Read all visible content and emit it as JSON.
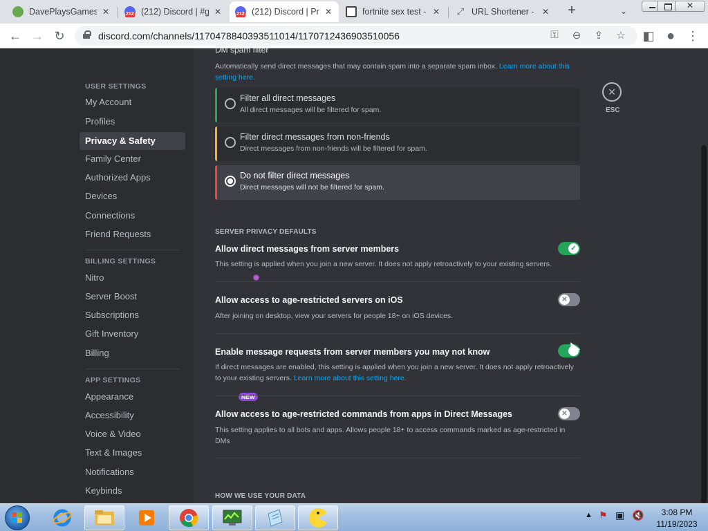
{
  "browser": {
    "tabs": [
      {
        "title": "DavePlaysGames",
        "favicon_color": "#6aa84f"
      },
      {
        "title": "(212) Discord | #g",
        "favicon_color": "#5865f2"
      },
      {
        "title": "(212) Discord | Pr",
        "favicon_color": "#5865f2"
      },
      {
        "title": "fortnite sex test -",
        "favicon_color": "#444444"
      },
      {
        "title": "URL Shortener - u",
        "favicon_color": "#666666"
      }
    ],
    "favicon_badge": "212",
    "new_tab_label": "+",
    "url": "discord.com/channels/1170478840393511014/1170712436903510056"
  },
  "dm_spam": {
    "heading": "DM spam filter",
    "description": "Automatically send direct messages that may contain spam into a separate spam inbox.",
    "link": "Learn more about this setting here.",
    "options": [
      {
        "title": "Filter all direct messages",
        "desc": "All direct messages will be filtered for spam.",
        "accent": "#23a55a",
        "selected": false
      },
      {
        "title": "Filter direct messages from non-friends",
        "desc": "Direct messages from non-friends will be filtered for spam.",
        "accent": "#f0b232",
        "selected": false
      },
      {
        "title": "Do not filter direct messages",
        "desc": "Direct messages will not be filtered for spam.",
        "accent": "#f23f43",
        "selected": true
      }
    ]
  },
  "server_privacy": {
    "header": "SERVER PRIVACY DEFAULTS",
    "settings": [
      {
        "title": "Allow direct messages from server members",
        "desc": "This setting is applied when you join a new server. It does not apply retroactively to your existing servers.",
        "on": true
      },
      {
        "title": "Allow access to age-restricted servers on iOS",
        "desc": "After joining on desktop, view your servers for people 18+ on iOS devices.",
        "on": false
      },
      {
        "title": "Enable message requests from server members you may not know",
        "desc": "If direct messages are enabled, this setting is applied when you join a new server. It does not apply retroactively to your existing servers.",
        "link": "Learn more about this setting here.",
        "on": true
      },
      {
        "title": "Allow access to age-restricted commands from apps in Direct Messages",
        "desc": "This setting applies to all bots and apps. Allows people 18+ to access commands marked as age-restricted in DMs",
        "on": false
      }
    ]
  },
  "data_header": "HOW WE USE YOUR DATA",
  "esc_label": "ESC",
  "sidebar": {
    "user_settings_header": "USER SETTINGS",
    "user_items": [
      "My Account",
      "Profiles",
      "Privacy & Safety",
      "Family Center",
      "Authorized Apps",
      "Devices",
      "Connections",
      "Friend Requests"
    ],
    "selected": "Privacy & Safety",
    "billing_header": "BILLING SETTINGS",
    "billing_items": [
      "Nitro",
      "Server Boost",
      "Subscriptions",
      "Gift Inventory",
      "Billing"
    ],
    "app_header": "APP SETTINGS",
    "app_items": [
      "Appearance",
      "Accessibility",
      "Voice & Video",
      "Text & Images",
      "Notifications",
      "Keybinds"
    ],
    "new_badge": "NEW"
  },
  "taskbar": {
    "time": "3:08 PM",
    "date": "11/19/2023"
  },
  "colors": {
    "discord_bg": "#313338",
    "sidebar_bg": "#2b2d31",
    "toggle_on": "#23a55a",
    "toggle_off": "#80848e",
    "link": "#00a8fc"
  }
}
